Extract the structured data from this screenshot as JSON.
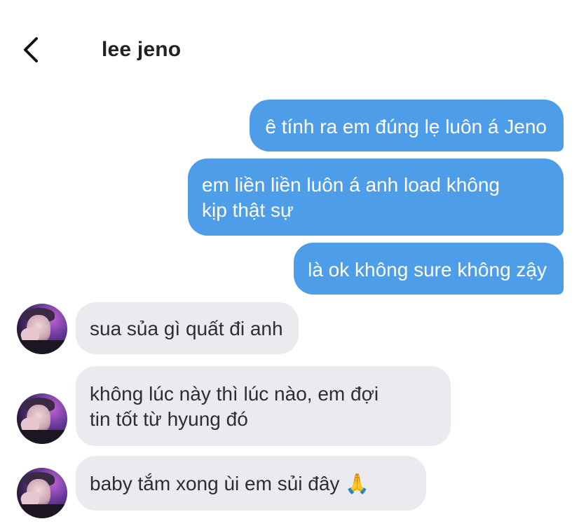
{
  "header": {
    "contact_name": "lee jeno",
    "back_icon": "chevron-left-icon"
  },
  "messages": [
    {
      "direction": "out",
      "lines": [
        "ê tính ra em đúng lẹ luôn á Jeno"
      ]
    },
    {
      "direction": "out",
      "lines": [
        "em liền liền luôn á anh load không",
        "kịp thật sự"
      ]
    },
    {
      "direction": "out",
      "lines": [
        "là ok không sure không zậy"
      ]
    },
    {
      "direction": "in",
      "lines": [
        "sua sủa gì quất đi anh"
      ]
    },
    {
      "direction": "in",
      "lines": [
        "không lúc này thì lúc nào, em đợi",
        "tin tốt từ hyung đó"
      ]
    },
    {
      "direction": "in",
      "lines": [
        "baby tắm xong ùi em sủi đây 🙏"
      ]
    }
  ],
  "colors": {
    "outgoing_bubble": "#4d9de8",
    "incoming_bubble": "#e9ebef",
    "background": "#ffffff"
  }
}
